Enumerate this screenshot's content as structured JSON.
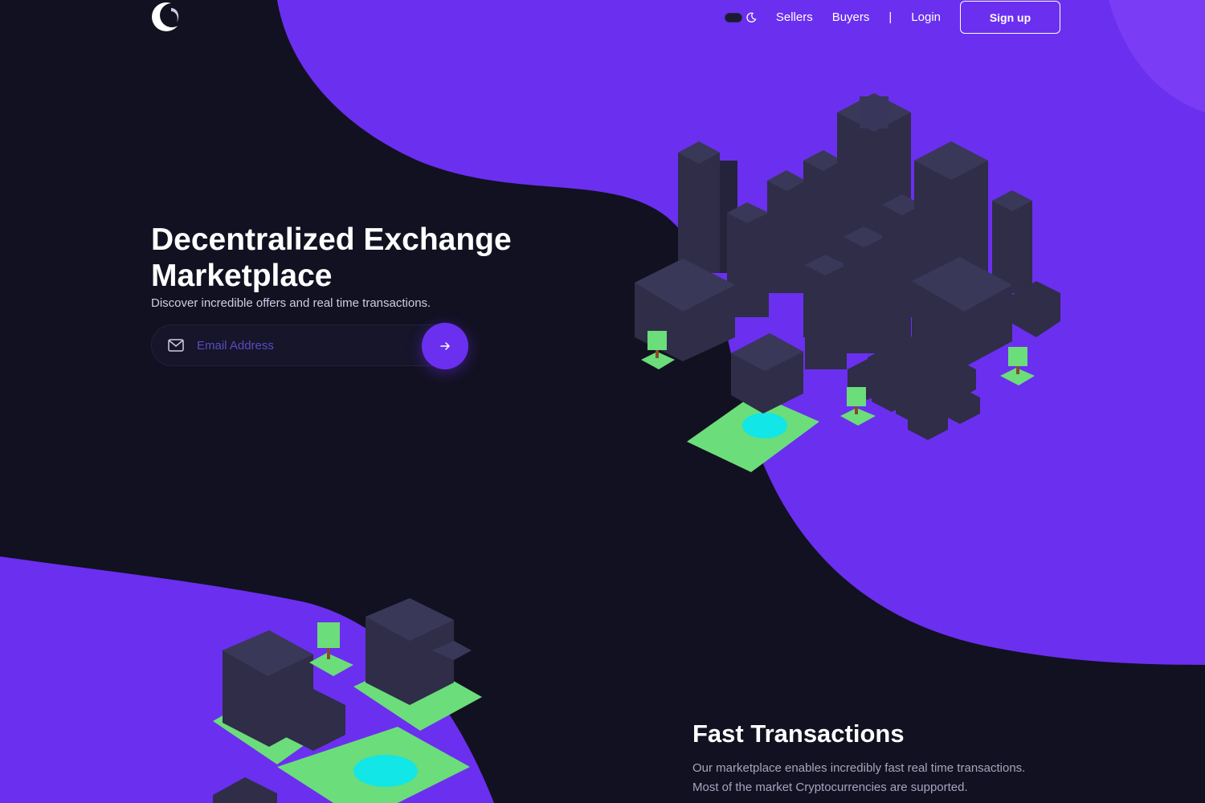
{
  "brand": {
    "logo_icon": "crescent-logo-icon"
  },
  "nav": {
    "theme_toggle_icon": "moon-icon",
    "links": [
      "Sellers",
      "Buyers"
    ],
    "separator": "|",
    "login": "Login",
    "signup": "Sign up"
  },
  "hero": {
    "title_line1": "Decentralized Exchange",
    "title_line2": "Marketplace",
    "subtitle": "Discover incredible offers and real time transactions.",
    "email_placeholder": "Email Address",
    "mail_icon": "mail-icon",
    "submit_icon": "arrow-right-icon"
  },
  "feature": {
    "title": "Fast Transactions",
    "text_line1": "Our marketplace enables incredibly fast real time transactions.",
    "text_line2": "Most of the market Cryptocurrencies are supported."
  },
  "colors": {
    "background": "#121121",
    "accent_purple": "#6b2ff0",
    "building": "#2f2d48",
    "grass": "#6bdd7a",
    "water": "#12e6e6"
  }
}
